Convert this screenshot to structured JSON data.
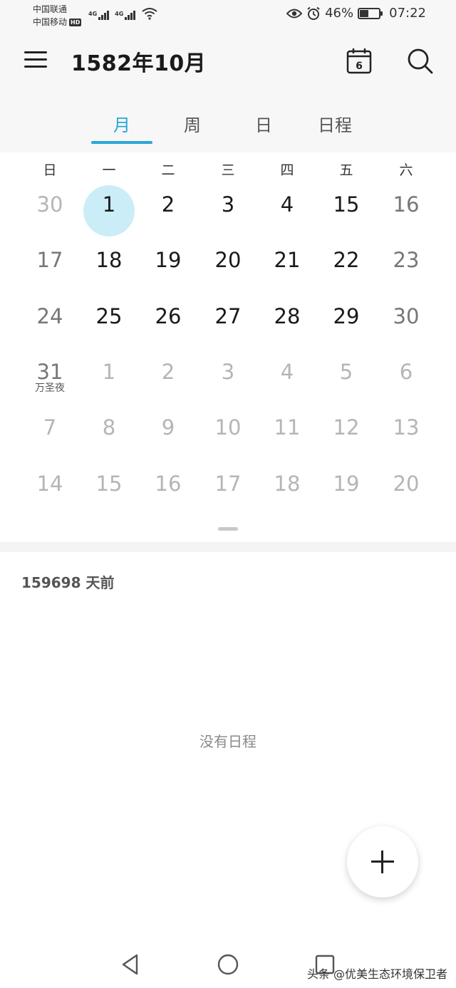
{
  "status_bar": {
    "carrier_1": "中国联通",
    "carrier_2": "中国移动",
    "hd_badge": "HD",
    "network_1": "4G",
    "network_2": "4G",
    "battery_percent": "46%",
    "battery_level": 0.46,
    "time": "07:22"
  },
  "app_bar": {
    "title": "1582年10月",
    "today_icon_day": "6"
  },
  "tabs": [
    {
      "label": "月",
      "active": true
    },
    {
      "label": "周",
      "active": false
    },
    {
      "label": "日",
      "active": false
    },
    {
      "label": "日程",
      "active": false
    }
  ],
  "calendar": {
    "weekdays": [
      "日",
      "一",
      "二",
      "三",
      "四",
      "五",
      "六"
    ],
    "weeks": [
      [
        {
          "d": "30",
          "s": "other"
        },
        {
          "d": "1",
          "s": "cur"
        },
        {
          "d": "2",
          "s": "cur"
        },
        {
          "d": "3",
          "s": "cur"
        },
        {
          "d": "4",
          "s": "cur"
        },
        {
          "d": "15",
          "s": "cur"
        },
        {
          "d": "16",
          "s": "weekend"
        }
      ],
      [
        {
          "d": "17",
          "s": "weekend"
        },
        {
          "d": "18",
          "s": "cur"
        },
        {
          "d": "19",
          "s": "cur"
        },
        {
          "d": "20",
          "s": "cur"
        },
        {
          "d": "21",
          "s": "cur"
        },
        {
          "d": "22",
          "s": "cur"
        },
        {
          "d": "23",
          "s": "weekend"
        }
      ],
      [
        {
          "d": "24",
          "s": "weekend"
        },
        {
          "d": "25",
          "s": "cur"
        },
        {
          "d": "26",
          "s": "cur"
        },
        {
          "d": "27",
          "s": "cur"
        },
        {
          "d": "28",
          "s": "cur"
        },
        {
          "d": "29",
          "s": "cur"
        },
        {
          "d": "30",
          "s": "weekend"
        }
      ],
      [
        {
          "d": "31",
          "s": "weekend",
          "note": "万圣夜"
        },
        {
          "d": "1",
          "s": "other"
        },
        {
          "d": "2",
          "s": "other"
        },
        {
          "d": "3",
          "s": "other"
        },
        {
          "d": "4",
          "s": "other"
        },
        {
          "d": "5",
          "s": "other"
        },
        {
          "d": "6",
          "s": "other"
        }
      ],
      [
        {
          "d": "7",
          "s": "other"
        },
        {
          "d": "8",
          "s": "other"
        },
        {
          "d": "9",
          "s": "other"
        },
        {
          "d": "10",
          "s": "other"
        },
        {
          "d": "11",
          "s": "other"
        },
        {
          "d": "12",
          "s": "other"
        },
        {
          "d": "13",
          "s": "other"
        }
      ],
      [
        {
          "d": "14",
          "s": "other"
        },
        {
          "d": "15",
          "s": "other"
        },
        {
          "d": "16",
          "s": "other"
        },
        {
          "d": "17",
          "s": "other"
        },
        {
          "d": "18",
          "s": "other"
        },
        {
          "d": "19",
          "s": "other"
        },
        {
          "d": "20",
          "s": "other"
        }
      ]
    ],
    "selected": {
      "week": 0,
      "day": 1
    }
  },
  "agenda": {
    "days_ago": "159698 天前",
    "empty_text": "没有日程"
  },
  "watermark": "头条 @优美生态环境保卫者",
  "colors": {
    "accent": "#2aa7d4",
    "selected_bg": "#cbedf8"
  }
}
